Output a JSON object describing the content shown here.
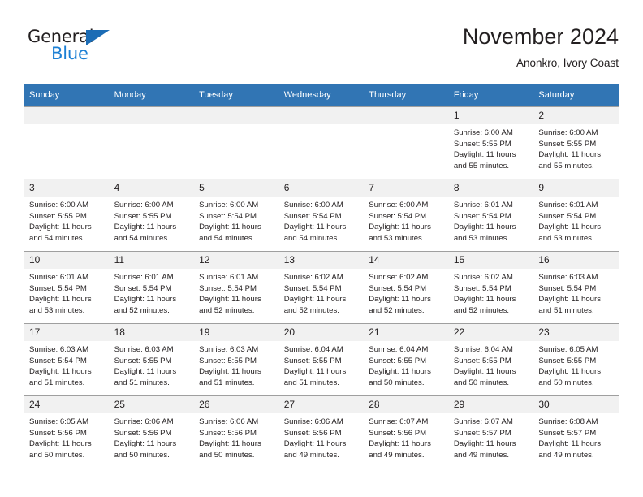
{
  "logo": {
    "word_one": "General",
    "word_two": "Blue",
    "triangle_color": "#1b6cb5",
    "blue_color": "#1b7fd4",
    "dark_color": "#231f20"
  },
  "header": {
    "title": "November 2024",
    "subtitle": "Anonkro, Ivory Coast"
  },
  "theme": {
    "header_bg": "#3175b4",
    "daynum_bg": "#f1f1f1",
    "grid_line": "#9f9f9f",
    "text": "#231f20"
  },
  "calendar": {
    "weekday_headers": [
      "Sunday",
      "Monday",
      "Tuesday",
      "Wednesday",
      "Thursday",
      "Friday",
      "Saturday"
    ],
    "weeks": [
      [
        {
          "day": "",
          "sunrise": "",
          "sunset": "",
          "daylight_line1": "",
          "daylight_line2": ""
        },
        {
          "day": "",
          "sunrise": "",
          "sunset": "",
          "daylight_line1": "",
          "daylight_line2": ""
        },
        {
          "day": "",
          "sunrise": "",
          "sunset": "",
          "daylight_line1": "",
          "daylight_line2": ""
        },
        {
          "day": "",
          "sunrise": "",
          "sunset": "",
          "daylight_line1": "",
          "daylight_line2": ""
        },
        {
          "day": "",
          "sunrise": "",
          "sunset": "",
          "daylight_line1": "",
          "daylight_line2": ""
        },
        {
          "day": "1",
          "sunrise": "Sunrise: 6:00 AM",
          "sunset": "Sunset: 5:55 PM",
          "daylight_line1": "Daylight: 11 hours",
          "daylight_line2": "and 55 minutes."
        },
        {
          "day": "2",
          "sunrise": "Sunrise: 6:00 AM",
          "sunset": "Sunset: 5:55 PM",
          "daylight_line1": "Daylight: 11 hours",
          "daylight_line2": "and 55 minutes."
        }
      ],
      [
        {
          "day": "3",
          "sunrise": "Sunrise: 6:00 AM",
          "sunset": "Sunset: 5:55 PM",
          "daylight_line1": "Daylight: 11 hours",
          "daylight_line2": "and 54 minutes."
        },
        {
          "day": "4",
          "sunrise": "Sunrise: 6:00 AM",
          "sunset": "Sunset: 5:55 PM",
          "daylight_line1": "Daylight: 11 hours",
          "daylight_line2": "and 54 minutes."
        },
        {
          "day": "5",
          "sunrise": "Sunrise: 6:00 AM",
          "sunset": "Sunset: 5:54 PM",
          "daylight_line1": "Daylight: 11 hours",
          "daylight_line2": "and 54 minutes."
        },
        {
          "day": "6",
          "sunrise": "Sunrise: 6:00 AM",
          "sunset": "Sunset: 5:54 PM",
          "daylight_line1": "Daylight: 11 hours",
          "daylight_line2": "and 54 minutes."
        },
        {
          "day": "7",
          "sunrise": "Sunrise: 6:00 AM",
          "sunset": "Sunset: 5:54 PM",
          "daylight_line1": "Daylight: 11 hours",
          "daylight_line2": "and 53 minutes."
        },
        {
          "day": "8",
          "sunrise": "Sunrise: 6:01 AM",
          "sunset": "Sunset: 5:54 PM",
          "daylight_line1": "Daylight: 11 hours",
          "daylight_line2": "and 53 minutes."
        },
        {
          "day": "9",
          "sunrise": "Sunrise: 6:01 AM",
          "sunset": "Sunset: 5:54 PM",
          "daylight_line1": "Daylight: 11 hours",
          "daylight_line2": "and 53 minutes."
        }
      ],
      [
        {
          "day": "10",
          "sunrise": "Sunrise: 6:01 AM",
          "sunset": "Sunset: 5:54 PM",
          "daylight_line1": "Daylight: 11 hours",
          "daylight_line2": "and 53 minutes."
        },
        {
          "day": "11",
          "sunrise": "Sunrise: 6:01 AM",
          "sunset": "Sunset: 5:54 PM",
          "daylight_line1": "Daylight: 11 hours",
          "daylight_line2": "and 52 minutes."
        },
        {
          "day": "12",
          "sunrise": "Sunrise: 6:01 AM",
          "sunset": "Sunset: 5:54 PM",
          "daylight_line1": "Daylight: 11 hours",
          "daylight_line2": "and 52 minutes."
        },
        {
          "day": "13",
          "sunrise": "Sunrise: 6:02 AM",
          "sunset": "Sunset: 5:54 PM",
          "daylight_line1": "Daylight: 11 hours",
          "daylight_line2": "and 52 minutes."
        },
        {
          "day": "14",
          "sunrise": "Sunrise: 6:02 AM",
          "sunset": "Sunset: 5:54 PM",
          "daylight_line1": "Daylight: 11 hours",
          "daylight_line2": "and 52 minutes."
        },
        {
          "day": "15",
          "sunrise": "Sunrise: 6:02 AM",
          "sunset": "Sunset: 5:54 PM",
          "daylight_line1": "Daylight: 11 hours",
          "daylight_line2": "and 52 minutes."
        },
        {
          "day": "16",
          "sunrise": "Sunrise: 6:03 AM",
          "sunset": "Sunset: 5:54 PM",
          "daylight_line1": "Daylight: 11 hours",
          "daylight_line2": "and 51 minutes."
        }
      ],
      [
        {
          "day": "17",
          "sunrise": "Sunrise: 6:03 AM",
          "sunset": "Sunset: 5:54 PM",
          "daylight_line1": "Daylight: 11 hours",
          "daylight_line2": "and 51 minutes."
        },
        {
          "day": "18",
          "sunrise": "Sunrise: 6:03 AM",
          "sunset": "Sunset: 5:55 PM",
          "daylight_line1": "Daylight: 11 hours",
          "daylight_line2": "and 51 minutes."
        },
        {
          "day": "19",
          "sunrise": "Sunrise: 6:03 AM",
          "sunset": "Sunset: 5:55 PM",
          "daylight_line1": "Daylight: 11 hours",
          "daylight_line2": "and 51 minutes."
        },
        {
          "day": "20",
          "sunrise": "Sunrise: 6:04 AM",
          "sunset": "Sunset: 5:55 PM",
          "daylight_line1": "Daylight: 11 hours",
          "daylight_line2": "and 51 minutes."
        },
        {
          "day": "21",
          "sunrise": "Sunrise: 6:04 AM",
          "sunset": "Sunset: 5:55 PM",
          "daylight_line1": "Daylight: 11 hours",
          "daylight_line2": "and 50 minutes."
        },
        {
          "day": "22",
          "sunrise": "Sunrise: 6:04 AM",
          "sunset": "Sunset: 5:55 PM",
          "daylight_line1": "Daylight: 11 hours",
          "daylight_line2": "and 50 minutes."
        },
        {
          "day": "23",
          "sunrise": "Sunrise: 6:05 AM",
          "sunset": "Sunset: 5:55 PM",
          "daylight_line1": "Daylight: 11 hours",
          "daylight_line2": "and 50 minutes."
        }
      ],
      [
        {
          "day": "24",
          "sunrise": "Sunrise: 6:05 AM",
          "sunset": "Sunset: 5:56 PM",
          "daylight_line1": "Daylight: 11 hours",
          "daylight_line2": "and 50 minutes."
        },
        {
          "day": "25",
          "sunrise": "Sunrise: 6:06 AM",
          "sunset": "Sunset: 5:56 PM",
          "daylight_line1": "Daylight: 11 hours",
          "daylight_line2": "and 50 minutes."
        },
        {
          "day": "26",
          "sunrise": "Sunrise: 6:06 AM",
          "sunset": "Sunset: 5:56 PM",
          "daylight_line1": "Daylight: 11 hours",
          "daylight_line2": "and 50 minutes."
        },
        {
          "day": "27",
          "sunrise": "Sunrise: 6:06 AM",
          "sunset": "Sunset: 5:56 PM",
          "daylight_line1": "Daylight: 11 hours",
          "daylight_line2": "and 49 minutes."
        },
        {
          "day": "28",
          "sunrise": "Sunrise: 6:07 AM",
          "sunset": "Sunset: 5:56 PM",
          "daylight_line1": "Daylight: 11 hours",
          "daylight_line2": "and 49 minutes."
        },
        {
          "day": "29",
          "sunrise": "Sunrise: 6:07 AM",
          "sunset": "Sunset: 5:57 PM",
          "daylight_line1": "Daylight: 11 hours",
          "daylight_line2": "and 49 minutes."
        },
        {
          "day": "30",
          "sunrise": "Sunrise: 6:08 AM",
          "sunset": "Sunset: 5:57 PM",
          "daylight_line1": "Daylight: 11 hours",
          "daylight_line2": "and 49 minutes."
        }
      ]
    ]
  }
}
